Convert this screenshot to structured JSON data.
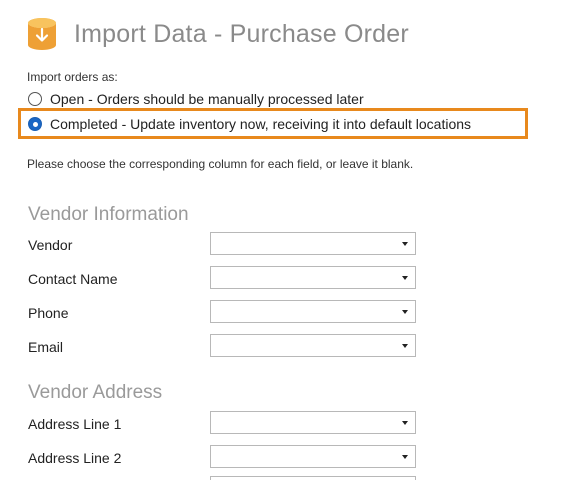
{
  "header": {
    "title": "Import Data - Purchase Order",
    "icon": "database-import-icon",
    "icon_color": "#f0a030"
  },
  "import_options": {
    "label": "Import orders as:",
    "options": [
      {
        "label": "Open - Orders should be manually processed later",
        "selected": false
      },
      {
        "label": "Completed - Update inventory now, receiving it into default locations",
        "selected": true
      }
    ],
    "highlight_color": "#e8891d"
  },
  "instructions": "Please choose the corresponding column for each field, or leave it blank.",
  "sections": [
    {
      "title": "Vendor Information",
      "fields": [
        {
          "label": "Vendor",
          "value": ""
        },
        {
          "label": "Contact Name",
          "value": ""
        },
        {
          "label": "Phone",
          "value": ""
        },
        {
          "label": "Email",
          "value": ""
        }
      ]
    },
    {
      "title": "Vendor Address",
      "fields": [
        {
          "label": "Address Line 1",
          "value": ""
        },
        {
          "label": "Address Line 2",
          "value": ""
        }
      ]
    }
  ]
}
